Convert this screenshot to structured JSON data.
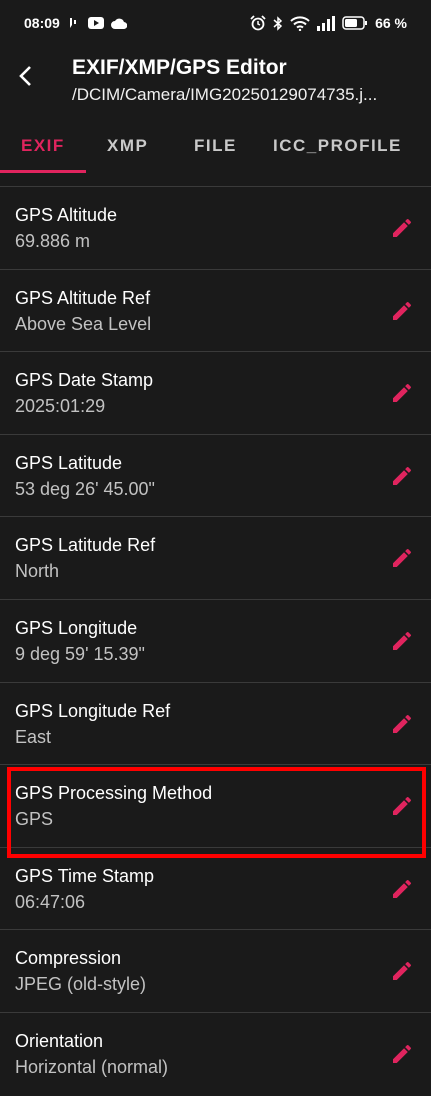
{
  "status_bar": {
    "time": "08:09",
    "battery": "66 %",
    "icons": [
      "voicemail-icon",
      "youtube-icon",
      "cloud-icon",
      "alarm-icon",
      "bluetooth-icon",
      "wifi-icon",
      "signal-icon",
      "battery-icon"
    ]
  },
  "app_bar": {
    "title": "EXIF/XMP/GPS Editor",
    "subtitle": "/DCIM/Camera/IMG20250129074735.j..."
  },
  "tabs": [
    {
      "label": "EXIF",
      "active": true
    },
    {
      "label": "XMP",
      "active": false
    },
    {
      "label": "FILE",
      "active": false
    },
    {
      "label": "ICC_PROFILE",
      "active": false
    }
  ],
  "rows": [
    {
      "label": "GPS Altitude",
      "value": "69.886 m"
    },
    {
      "label": "GPS Altitude Ref",
      "value": "Above Sea Level"
    },
    {
      "label": "GPS Date Stamp",
      "value": "2025:01:29"
    },
    {
      "label": "GPS Latitude",
      "value": "53 deg 26' 45.00\""
    },
    {
      "label": "GPS Latitude Ref",
      "value": "North"
    },
    {
      "label": "GPS Longitude",
      "value": "9 deg 59' 15.39\""
    },
    {
      "label": "GPS Longitude Ref",
      "value": "East"
    },
    {
      "label": "GPS Processing Method",
      "value": "GPS"
    },
    {
      "label": "GPS Time Stamp",
      "value": "06:47:06"
    },
    {
      "label": "Compression",
      "value": "JPEG (old-style)"
    },
    {
      "label": "Orientation",
      "value": "Horizontal (normal)"
    }
  ],
  "colors": {
    "background": "#1a1a1a",
    "accent": "#e0245e",
    "divider": "#3a3a3a",
    "highlight_box": "#ff0000"
  }
}
